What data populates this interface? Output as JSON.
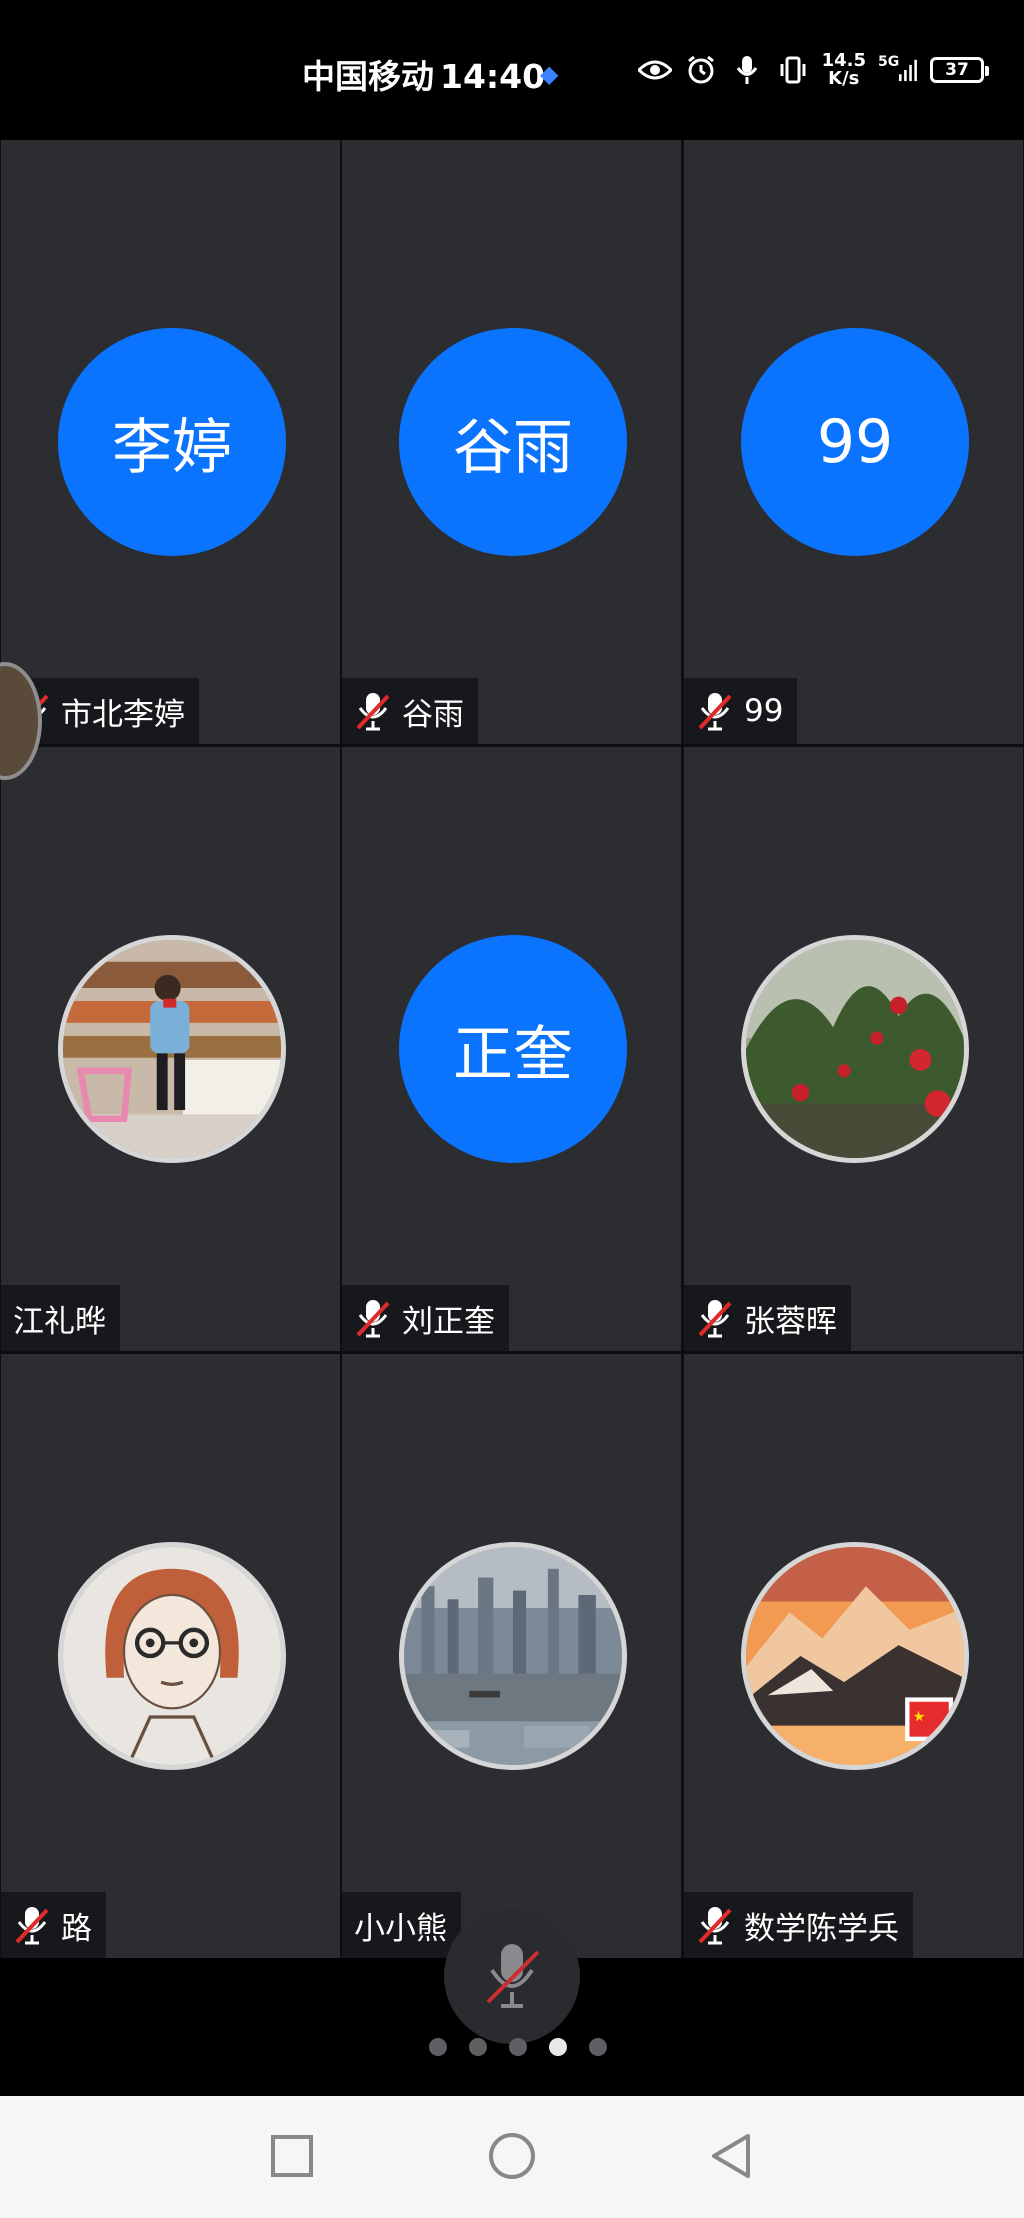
{
  "status_bar": {
    "carrier": "中国移动",
    "time": "14:40",
    "net_speed_value": "14.5",
    "net_speed_unit": "K/s",
    "network": "5G",
    "battery": "37"
  },
  "participants": [
    {
      "name": "市北李婷",
      "avatar_text": "李婷",
      "avatar_type": "initials",
      "muted": true
    },
    {
      "name": "谷雨",
      "avatar_text": "谷雨",
      "avatar_type": "initials",
      "muted": true
    },
    {
      "name": "99",
      "avatar_text": "99",
      "avatar_type": "initials",
      "muted": true
    },
    {
      "name": "江礼晔",
      "avatar_type": "photo",
      "avatar_icon": "person-shopping-photo",
      "muted": false
    },
    {
      "name": "刘正奎",
      "avatar_text": "正奎",
      "avatar_type": "initials",
      "muted": true
    },
    {
      "name": "张蓉晖",
      "avatar_type": "photo",
      "avatar_icon": "red-flowers-photo",
      "muted": true
    },
    {
      "name": "路",
      "avatar_type": "photo",
      "avatar_icon": "cartoon-girl-photo",
      "muted": true
    },
    {
      "name": "小小熊",
      "avatar_type": "photo",
      "avatar_icon": "city-river-photo",
      "muted": false
    },
    {
      "name": "数学陈学兵",
      "avatar_type": "photo",
      "avatar_icon": "sunset-mountain-photo",
      "muted": true
    }
  ],
  "controls": {
    "mic_icon": "mic-muted-icon",
    "pages": 5,
    "active_page": 4
  },
  "colors": {
    "avatar_blue": "#0a74ff",
    "tile_bg": "#2b2d31",
    "mute_red": "#e02b2b"
  }
}
